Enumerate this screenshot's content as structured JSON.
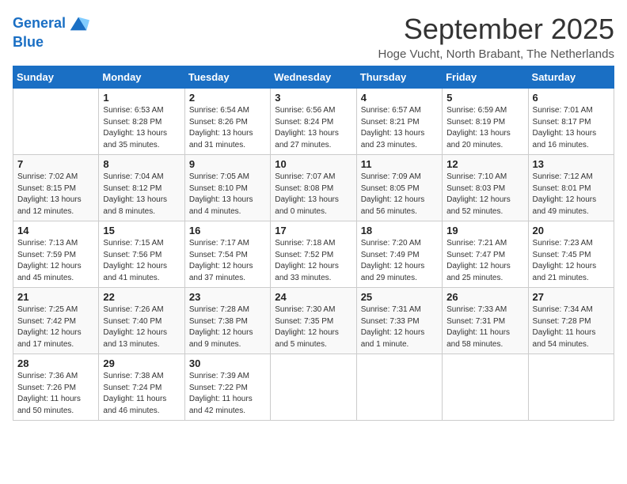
{
  "logo": {
    "line1": "General",
    "line2": "Blue"
  },
  "title": "September 2025",
  "location": "Hoge Vucht, North Brabant, The Netherlands",
  "header_days": [
    "Sunday",
    "Monday",
    "Tuesday",
    "Wednesday",
    "Thursday",
    "Friday",
    "Saturday"
  ],
  "weeks": [
    [
      {
        "day": "",
        "info": ""
      },
      {
        "day": "1",
        "info": "Sunrise: 6:53 AM\nSunset: 8:28 PM\nDaylight: 13 hours\nand 35 minutes."
      },
      {
        "day": "2",
        "info": "Sunrise: 6:54 AM\nSunset: 8:26 PM\nDaylight: 13 hours\nand 31 minutes."
      },
      {
        "day": "3",
        "info": "Sunrise: 6:56 AM\nSunset: 8:24 PM\nDaylight: 13 hours\nand 27 minutes."
      },
      {
        "day": "4",
        "info": "Sunrise: 6:57 AM\nSunset: 8:21 PM\nDaylight: 13 hours\nand 23 minutes."
      },
      {
        "day": "5",
        "info": "Sunrise: 6:59 AM\nSunset: 8:19 PM\nDaylight: 13 hours\nand 20 minutes."
      },
      {
        "day": "6",
        "info": "Sunrise: 7:01 AM\nSunset: 8:17 PM\nDaylight: 13 hours\nand 16 minutes."
      }
    ],
    [
      {
        "day": "7",
        "info": "Sunrise: 7:02 AM\nSunset: 8:15 PM\nDaylight: 13 hours\nand 12 minutes."
      },
      {
        "day": "8",
        "info": "Sunrise: 7:04 AM\nSunset: 8:12 PM\nDaylight: 13 hours\nand 8 minutes."
      },
      {
        "day": "9",
        "info": "Sunrise: 7:05 AM\nSunset: 8:10 PM\nDaylight: 13 hours\nand 4 minutes."
      },
      {
        "day": "10",
        "info": "Sunrise: 7:07 AM\nSunset: 8:08 PM\nDaylight: 13 hours\nand 0 minutes."
      },
      {
        "day": "11",
        "info": "Sunrise: 7:09 AM\nSunset: 8:05 PM\nDaylight: 12 hours\nand 56 minutes."
      },
      {
        "day": "12",
        "info": "Sunrise: 7:10 AM\nSunset: 8:03 PM\nDaylight: 12 hours\nand 52 minutes."
      },
      {
        "day": "13",
        "info": "Sunrise: 7:12 AM\nSunset: 8:01 PM\nDaylight: 12 hours\nand 49 minutes."
      }
    ],
    [
      {
        "day": "14",
        "info": "Sunrise: 7:13 AM\nSunset: 7:59 PM\nDaylight: 12 hours\nand 45 minutes."
      },
      {
        "day": "15",
        "info": "Sunrise: 7:15 AM\nSunset: 7:56 PM\nDaylight: 12 hours\nand 41 minutes."
      },
      {
        "day": "16",
        "info": "Sunrise: 7:17 AM\nSunset: 7:54 PM\nDaylight: 12 hours\nand 37 minutes."
      },
      {
        "day": "17",
        "info": "Sunrise: 7:18 AM\nSunset: 7:52 PM\nDaylight: 12 hours\nand 33 minutes."
      },
      {
        "day": "18",
        "info": "Sunrise: 7:20 AM\nSunset: 7:49 PM\nDaylight: 12 hours\nand 29 minutes."
      },
      {
        "day": "19",
        "info": "Sunrise: 7:21 AM\nSunset: 7:47 PM\nDaylight: 12 hours\nand 25 minutes."
      },
      {
        "day": "20",
        "info": "Sunrise: 7:23 AM\nSunset: 7:45 PM\nDaylight: 12 hours\nand 21 minutes."
      }
    ],
    [
      {
        "day": "21",
        "info": "Sunrise: 7:25 AM\nSunset: 7:42 PM\nDaylight: 12 hours\nand 17 minutes."
      },
      {
        "day": "22",
        "info": "Sunrise: 7:26 AM\nSunset: 7:40 PM\nDaylight: 12 hours\nand 13 minutes."
      },
      {
        "day": "23",
        "info": "Sunrise: 7:28 AM\nSunset: 7:38 PM\nDaylight: 12 hours\nand 9 minutes."
      },
      {
        "day": "24",
        "info": "Sunrise: 7:30 AM\nSunset: 7:35 PM\nDaylight: 12 hours\nand 5 minutes."
      },
      {
        "day": "25",
        "info": "Sunrise: 7:31 AM\nSunset: 7:33 PM\nDaylight: 12 hours\nand 1 minute."
      },
      {
        "day": "26",
        "info": "Sunrise: 7:33 AM\nSunset: 7:31 PM\nDaylight: 11 hours\nand 58 minutes."
      },
      {
        "day": "27",
        "info": "Sunrise: 7:34 AM\nSunset: 7:28 PM\nDaylight: 11 hours\nand 54 minutes."
      }
    ],
    [
      {
        "day": "28",
        "info": "Sunrise: 7:36 AM\nSunset: 7:26 PM\nDaylight: 11 hours\nand 50 minutes."
      },
      {
        "day": "29",
        "info": "Sunrise: 7:38 AM\nSunset: 7:24 PM\nDaylight: 11 hours\nand 46 minutes."
      },
      {
        "day": "30",
        "info": "Sunrise: 7:39 AM\nSunset: 7:22 PM\nDaylight: 11 hours\nand 42 minutes."
      },
      {
        "day": "",
        "info": ""
      },
      {
        "day": "",
        "info": ""
      },
      {
        "day": "",
        "info": ""
      },
      {
        "day": "",
        "info": ""
      }
    ]
  ]
}
